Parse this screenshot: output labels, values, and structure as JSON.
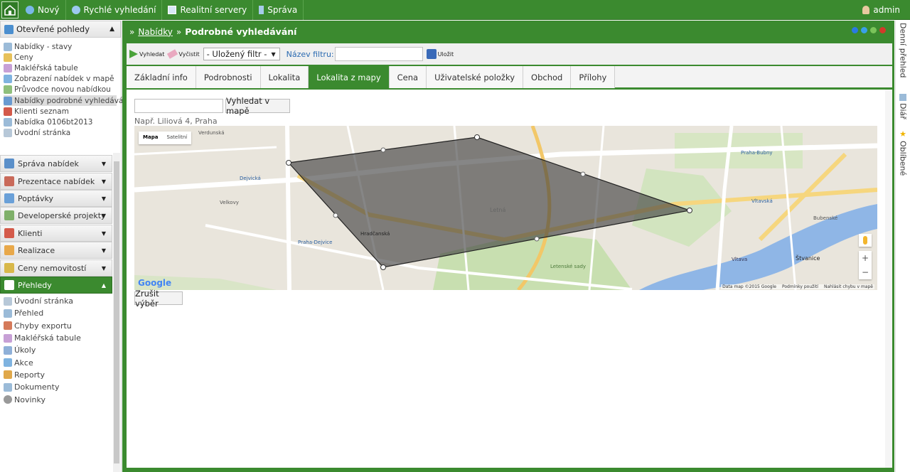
{
  "topnav": {
    "items": [
      {
        "label": "Nový",
        "icon": "new-icon"
      },
      {
        "label": "Rychlé vyhledání",
        "icon": "search-icon"
      },
      {
        "label": "Realitní servery",
        "icon": "server-icon"
      },
      {
        "label": "Správa",
        "icon": "tools-icon"
      }
    ],
    "user": "admin"
  },
  "sidebar": {
    "open_views_title": "Otevřené pohledy",
    "open_views": [
      "Nabídky - stavy",
      "Ceny",
      "Makléřská tabule",
      "Zobrazení nabídek v mapě",
      "Průvodce novou nabídkou",
      "Nabídky podrobné vyhledávání",
      "Klienti seznam",
      "Nabídka 0106bt2013",
      "Úvodní stránka"
    ],
    "sections": [
      "Správa nabídek",
      "Prezentace nabídek",
      "Poptávky",
      "Developerské projekty",
      "Klienti",
      "Realizace",
      "Ceny nemovitostí",
      "Přehledy"
    ],
    "prehledy_items": [
      "Úvodní stránka",
      "Přehled",
      "Chyby exportu",
      "Makléřská tabule",
      "Úkoly",
      "Akce",
      "Reporty",
      "Dokumenty",
      "Novinky"
    ]
  },
  "breadcrumb": {
    "sep": "»",
    "link": "Nabídky",
    "current": "Podrobné vyhledávání"
  },
  "toolbar": {
    "search_label": "Vyhledat",
    "clear_label": "Vyčistit",
    "saved_filter": "- Uložený filtr -",
    "filter_name_label": "Název filtru:",
    "save_label": "Uložit"
  },
  "tabs": [
    "Základní info",
    "Podrobnosti",
    "Lokalita",
    "Lokalita z mapy",
    "Cena",
    "Uživatelské položky",
    "Obchod",
    "Přílohy"
  ],
  "map_panel": {
    "search_button": "Vyhledat v mapě",
    "hint": "Např. Liliová 4, Praha",
    "map_type_map": "Mapa",
    "map_type_sat": "Satelitní",
    "footer": [
      "Data map ©2015 Google",
      "Podmínky použití",
      "Nahlásit chybu v mapě"
    ],
    "cancel_button": "Zrušit výběr",
    "labels": [
      "Verdunská",
      "Praha-Bubny",
      "Dejvická",
      "Velkovy",
      "Letná",
      "Letenské sady",
      "Vltava",
      "Štvanice",
      "Hradčanská",
      "Praha-Dejvice",
      "Vltavská",
      "Bubenské"
    ]
  },
  "right_tabs": [
    "Denní přehled",
    "Diář",
    "Oblíbené"
  ]
}
